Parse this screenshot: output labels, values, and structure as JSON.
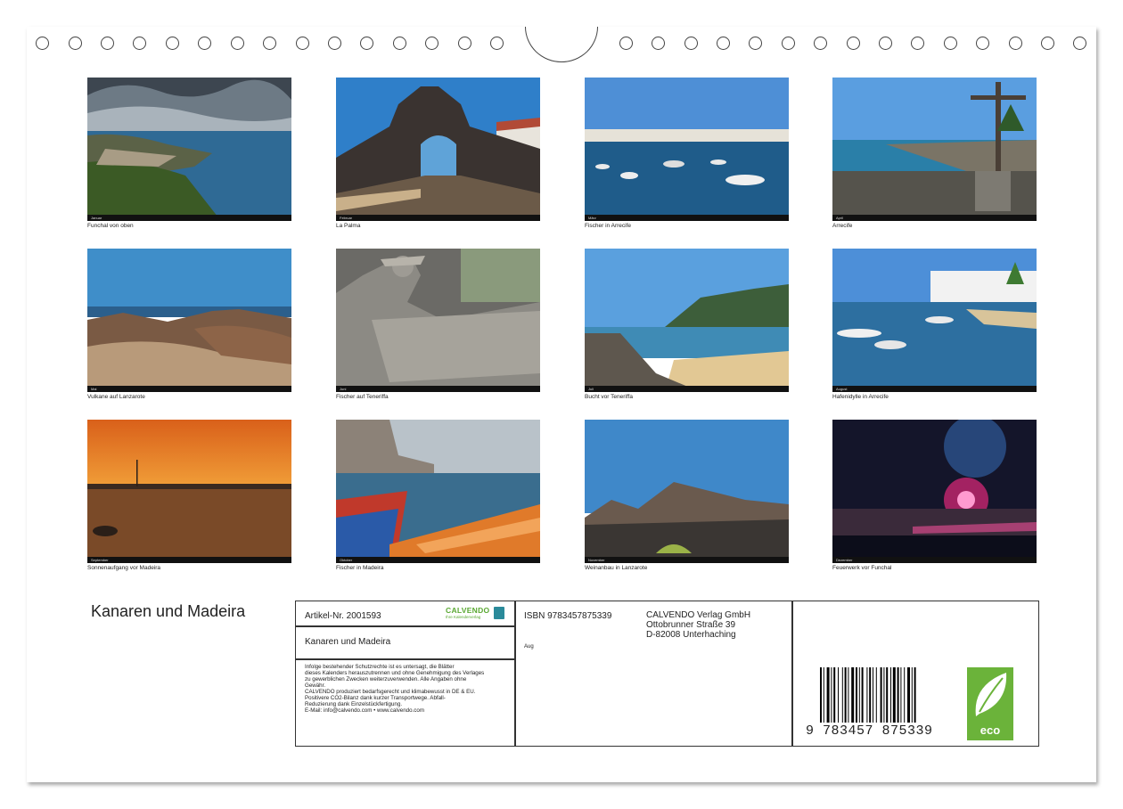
{
  "calendar_title": "Kanaren und Madeira",
  "photos": [
    {
      "caption": "Funchal von oben",
      "month": "Januar"
    },
    {
      "caption": "La Palma",
      "month": "Februar"
    },
    {
      "caption": "Fischer in Arrecife",
      "month": "März"
    },
    {
      "caption": "Arrecife",
      "month": "April"
    },
    {
      "caption": "Vulkane auf Lanzarote",
      "month": "Mai"
    },
    {
      "caption": "Fischer auf Teneriffa",
      "month": "Juni"
    },
    {
      "caption": "Bucht vor Teneriffa",
      "month": "Juli"
    },
    {
      "caption": "Hafenidylle in Arrecife",
      "month": "August"
    },
    {
      "caption": "Sonnenaufgang vor Madeira",
      "month": "September"
    },
    {
      "caption": "Fischer in Madeira",
      "month": "Oktober"
    },
    {
      "caption": "Weinanbau in Lanzarote",
      "month": "November"
    },
    {
      "caption": "Feuerwerk vor Funchal",
      "month": "Dezember"
    }
  ],
  "info_box": {
    "article_number": "Artikel-Nr. 2001593",
    "brand": "CALVENDO",
    "brand_sub": "Ihre Kalenderverlag",
    "title": "Kanaren und Madeira",
    "legal_text": [
      "Infolge bestehender Schutzrechte ist es untersagt, die Blätter",
      "dieses Kalenders herauszutrennen und ohne Genehmigung des Verlages",
      "zu gewerblichen Zwecken weiterzuverwenden. Alle Angaben ohne",
      "Gewähr.",
      "CALVENDO produziert bedarfsgerecht und klimabewusst in DE & EU.",
      "Positivere CO2-Bilanz dank kurzer Transportwege. Abfall-",
      "Reduzierung dank Einzelstückfertigung.",
      "E-Mail: info@calvendo.com • www.calvendo.com"
    ],
    "isbn": "ISBN 9783457875339",
    "edition": "Aug",
    "publisher": [
      "CALVENDO Verlag GmbH",
      "Ottobrunner Straße 39",
      "D-82008 Unterhaching"
    ],
    "barcode_digits": "9 783457 875339",
    "eco_label": "eco"
  },
  "colors": {
    "brand_green": "#5aa832",
    "eco_green": "#6bb33a",
    "border": "#333333"
  }
}
